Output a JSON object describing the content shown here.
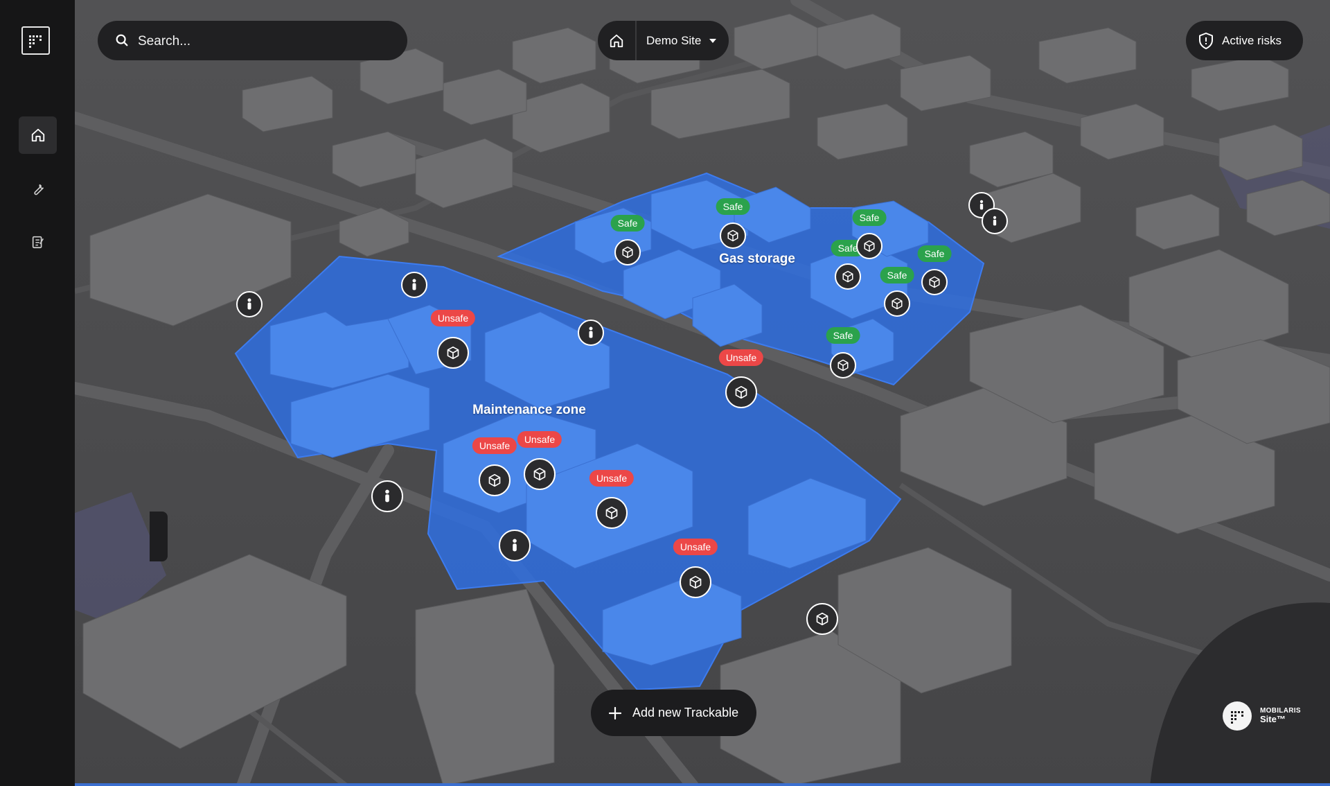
{
  "search": {
    "placeholder": "Search..."
  },
  "site": {
    "name": "Demo Site"
  },
  "active_risks": {
    "label": "Active risks"
  },
  "add_trackable": {
    "label": "Add new Trackable"
  },
  "brand": {
    "line1": "MOBILARIS",
    "line2": "Site™"
  },
  "zones": [
    {
      "name": "Maintenance zone"
    },
    {
      "name": "Gas storage"
    }
  ],
  "tags": {
    "safe": "Safe",
    "unsafe": "Unsafe"
  },
  "sidebar": {
    "items": [
      {
        "name": "home",
        "icon": "home-icon",
        "active": true
      },
      {
        "name": "tools",
        "icon": "wrench-icon",
        "active": false
      },
      {
        "name": "reports",
        "icon": "notepad-icon",
        "active": false
      }
    ]
  },
  "colors": {
    "zone_fill": "#2f6fe0",
    "safe": "#2ba24c",
    "unsafe": "#ec4747",
    "map_ground": "#4c4c4e",
    "panel": "#202022"
  }
}
